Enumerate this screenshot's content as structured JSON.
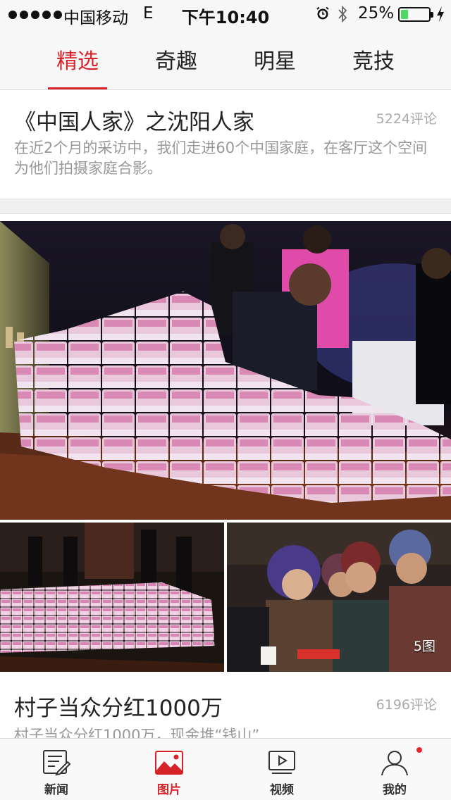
{
  "status_bar": {
    "carrier": "中国移动",
    "network": "E",
    "time": "下午10:40",
    "battery_percent": "25%",
    "battery_level": 0.25
  },
  "tabs": [
    {
      "label": "精选",
      "active": true
    },
    {
      "label": "奇趣",
      "active": false
    },
    {
      "label": "明星",
      "active": false
    },
    {
      "label": "竞技",
      "active": false
    }
  ],
  "article1": {
    "title": "《中国人家》之沈阳人家",
    "comments": "5224评论",
    "description": "在近2个月的采访中，我们走进60个中国家庭，在客厅这个空间为他们拍摄家庭合影。"
  },
  "gallery": {
    "photo_count": "5图"
  },
  "article2": {
    "title": "村子当众分红1000万",
    "comments": "6196评论",
    "description": "村子当众分红1000万，现金堆“钱山”"
  },
  "bottom_nav": [
    {
      "label": "新闻",
      "icon": "news-icon",
      "active": false
    },
    {
      "label": "图片",
      "icon": "picture-icon",
      "active": true
    },
    {
      "label": "视频",
      "icon": "video-icon",
      "active": false
    },
    {
      "label": "我的",
      "icon": "profile-icon",
      "active": false,
      "badge": true
    }
  ],
  "colors": {
    "accent": "#d6232a",
    "battery": "#4cd964",
    "muted_text": "#999999"
  }
}
